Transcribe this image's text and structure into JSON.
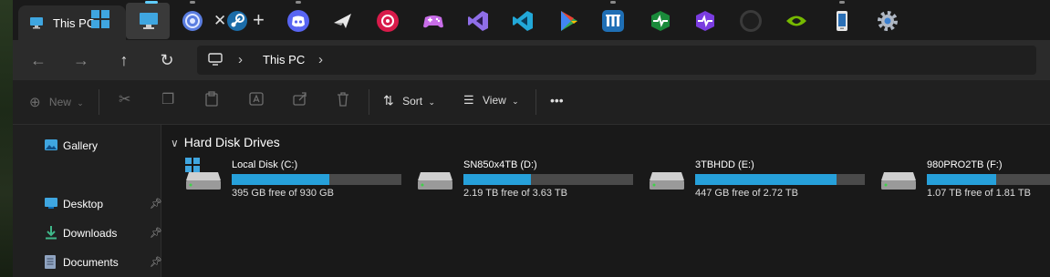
{
  "tab": {
    "title": "This PC"
  },
  "taskbar": {
    "icons": [
      "windows-start",
      "file-explorer",
      "settings-circle",
      "steam",
      "discord",
      "flight-app",
      "media-player",
      "game-controller",
      "visual-studio",
      "vscode",
      "play-store",
      "chart-app",
      "heart-monitor",
      "pulse-app",
      "obs",
      "nvidia",
      "phone-link",
      "settings-gear"
    ]
  },
  "address": {
    "crumb": "This PC"
  },
  "commands": {
    "new": "New",
    "sort": "Sort",
    "view": "View",
    "more": "•••"
  },
  "sidebar": {
    "items": [
      {
        "label": "Gallery",
        "pinned": false
      },
      {
        "label": "Desktop",
        "pinned": true
      },
      {
        "label": "Downloads",
        "pinned": true
      },
      {
        "label": "Documents",
        "pinned": true
      }
    ]
  },
  "main": {
    "section": "Hard Disk Drives",
    "drives": [
      {
        "name": "Local Disk (C:)",
        "free": "395 GB free of 930 GB",
        "used_fraction": 0.575,
        "system": true
      },
      {
        "name": "SN850x4TB (D:)",
        "free": "2.19 TB free of 3.63 TB",
        "used_fraction": 0.397,
        "system": false
      },
      {
        "name": "3TBHDD (E:)",
        "free": "447 GB free of 2.72 TB",
        "used_fraction": 0.836,
        "system": false
      },
      {
        "name": "980PRO2TB (F:)",
        "free": "1.07 TB free of 1.81 TB",
        "used_fraction": 0.409,
        "system": false
      }
    ]
  },
  "colors": {
    "accent": "#26a0da",
    "bar_bg": "#4a4a4a"
  }
}
